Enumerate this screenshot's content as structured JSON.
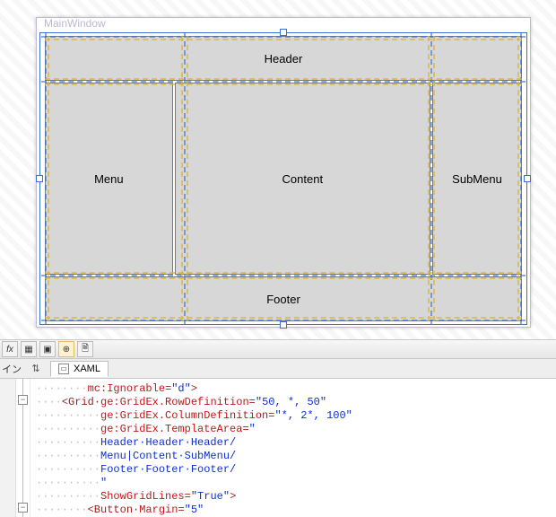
{
  "designer": {
    "window_title": "MainWindow",
    "cells": {
      "header": "Header",
      "menu": "Menu",
      "content": "Content",
      "submenu": "SubMenu",
      "footer": "Footer"
    }
  },
  "toolbar": {
    "items": [
      "fx",
      "grid-3x3",
      "grid-2x2",
      "align-center",
      "paste"
    ]
  },
  "tabbar": {
    "left_label": "イン",
    "xaml_label": "XAML"
  },
  "code": {
    "lines": [
      {
        "indent": 2,
        "dots": "········",
        "segs": [
          {
            "cls": "c-attr",
            "t": "mc:Ignorable"
          },
          {
            "cls": "c-el",
            "t": "="
          },
          {
            "cls": "c-val",
            "t": "\"d\""
          },
          {
            "cls": "c-el",
            "t": ">"
          }
        ]
      },
      {
        "indent": 1,
        "dots": "····",
        "segs": [
          {
            "cls": "c-el",
            "t": "<Grid·"
          },
          {
            "cls": "c-attr",
            "t": "ge:GridEx.RowDefinition"
          },
          {
            "cls": "c-el",
            "t": "="
          },
          {
            "cls": "c-val",
            "t": "\"50, *, 50\""
          }
        ]
      },
      {
        "indent": 2,
        "dots": "··········",
        "segs": [
          {
            "cls": "c-attr",
            "t": "ge:GridEx.ColumnDefinition"
          },
          {
            "cls": "c-el",
            "t": "="
          },
          {
            "cls": "c-val",
            "t": "\"*, 2*, 100\""
          }
        ]
      },
      {
        "indent": 2,
        "dots": "··········",
        "segs": [
          {
            "cls": "c-attr",
            "t": "ge:GridEx.TemplateArea"
          },
          {
            "cls": "c-el",
            "t": "="
          },
          {
            "cls": "c-val",
            "t": "\""
          }
        ]
      },
      {
        "indent": 2,
        "dots": "··········",
        "segs": [
          {
            "cls": "c-txt",
            "t": "Header·Header·Header/"
          }
        ]
      },
      {
        "indent": 2,
        "dots": "··········",
        "segs": [
          {
            "cls": "c-txt",
            "t": "Menu|Content·SubMenu/"
          }
        ]
      },
      {
        "indent": 2,
        "dots": "··········",
        "segs": [
          {
            "cls": "c-txt",
            "t": "Footer·Footer·Footer/"
          }
        ]
      },
      {
        "indent": 2,
        "dots": "··········",
        "segs": [
          {
            "cls": "c-val",
            "t": "\""
          }
        ]
      },
      {
        "indent": 2,
        "dots": "··········",
        "segs": [
          {
            "cls": "c-attr",
            "t": "ShowGridLines"
          },
          {
            "cls": "c-el",
            "t": "="
          },
          {
            "cls": "c-val",
            "t": "\"True\""
          },
          {
            "cls": "c-el",
            "t": ">"
          }
        ]
      },
      {
        "indent": 2,
        "dots": "········",
        "segs": [
          {
            "cls": "c-el",
            "t": "<Button·"
          },
          {
            "cls": "c-attr",
            "t": "Margin"
          },
          {
            "cls": "c-el",
            "t": "="
          },
          {
            "cls": "c-val",
            "t": "\"5\""
          }
        ]
      }
    ]
  }
}
